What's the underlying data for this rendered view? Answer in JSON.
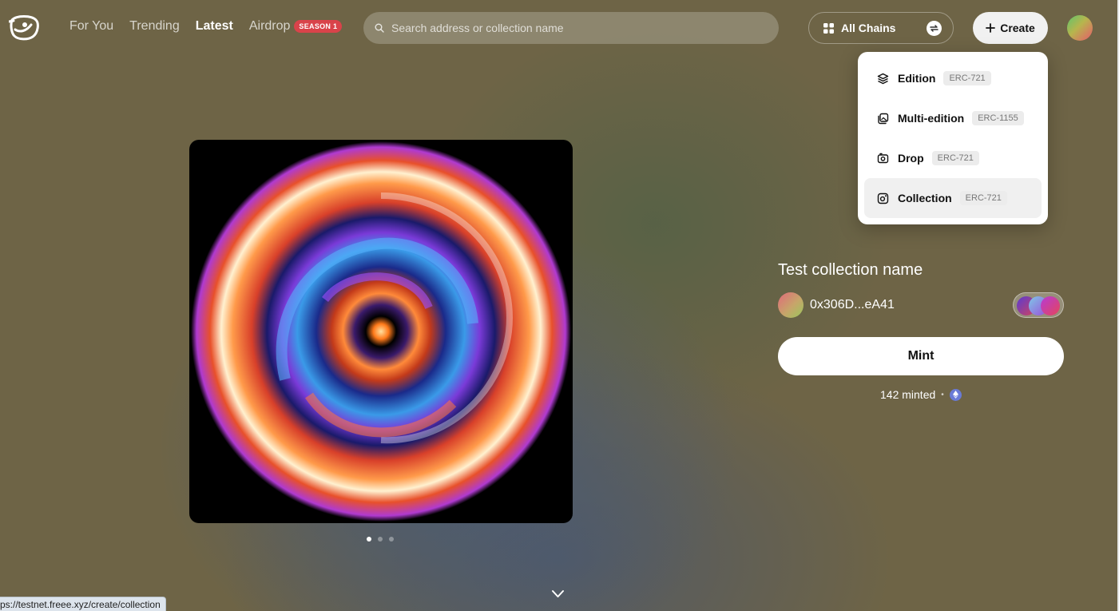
{
  "nav": {
    "items": [
      {
        "label": "For You"
      },
      {
        "label": "Trending"
      },
      {
        "label": "Latest"
      },
      {
        "label": "Airdrop"
      }
    ],
    "active": "Latest",
    "airdrop_badge": "SEASON 1"
  },
  "search": {
    "placeholder": "Search address or collection name",
    "value": ""
  },
  "chains": {
    "label": "All Chains"
  },
  "create": {
    "label": "Create"
  },
  "create_menu": {
    "items": [
      {
        "label": "Edition",
        "tag": "ERC-721",
        "icon": "layers-icon"
      },
      {
        "label": "Multi-edition",
        "tag": "ERC-1155",
        "icon": "stacked-images-icon"
      },
      {
        "label": "Drop",
        "tag": "ERC-721",
        "icon": "drop-icon"
      },
      {
        "label": "Collection",
        "tag": "ERC-721",
        "icon": "collection-icon"
      }
    ],
    "highlighted": "Collection"
  },
  "collection": {
    "name": "Test collection name",
    "creator_address": "0x306D...eA41",
    "mint_label": "Mint",
    "minted_text": "142 minted",
    "separator": "•",
    "chain_icon": "ethereum-icon"
  },
  "carousel": {
    "total": 3,
    "active_index": 0
  },
  "status_bar": {
    "url": "ps://testnet.freee.xyz/create/collection"
  },
  "colors": {
    "background": "#6e6446",
    "season_badge": "#d9434a",
    "eth_badge": "#6a7bd6"
  }
}
